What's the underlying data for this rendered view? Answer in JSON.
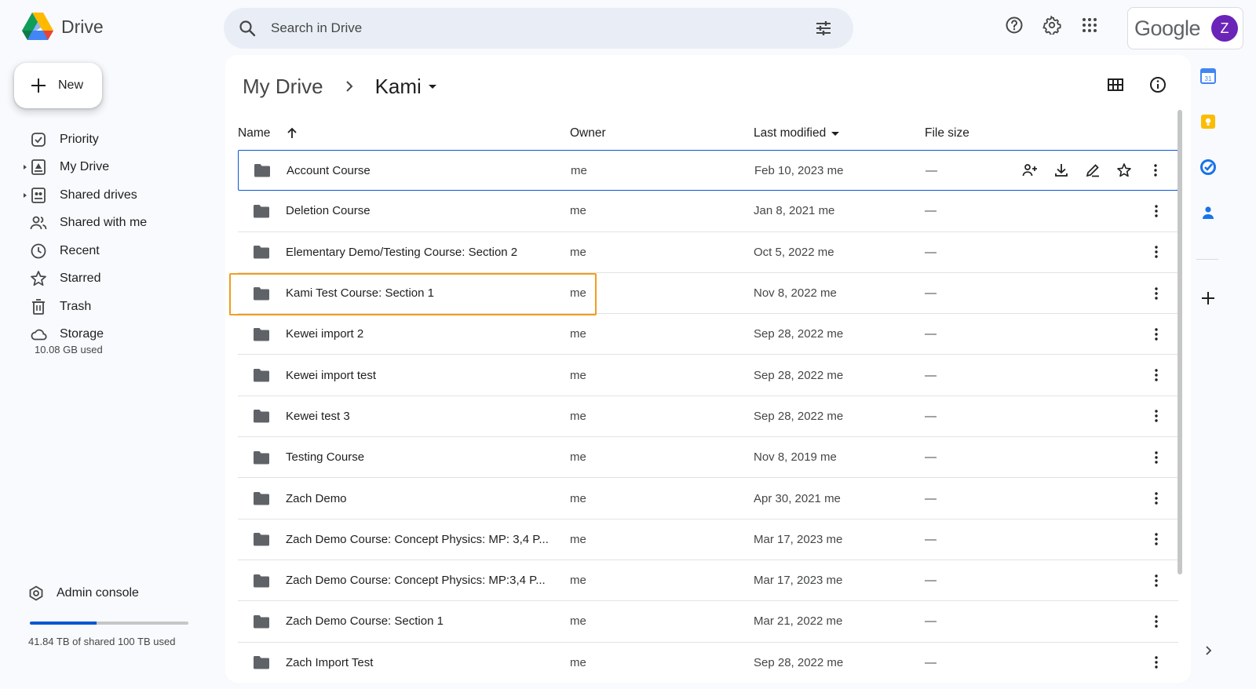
{
  "app": {
    "title": "Drive",
    "brand_colors": {
      "blue": "#4285f4",
      "green": "#0f9d58",
      "yellow": "#f4b400",
      "red": "#db4437"
    }
  },
  "search": {
    "placeholder": "Search in Drive",
    "icon": "search-icon",
    "filter_icon": "tune-icon"
  },
  "header_icons": [
    "help-icon",
    "settings-icon",
    "apps-grid-icon"
  ],
  "account": {
    "brand": "Google",
    "avatar_letter": "Z",
    "avatar_color": "#6a24b8"
  },
  "new_button": {
    "label": "New"
  },
  "sidebar": {
    "items": [
      {
        "label": "Priority",
        "icon": "priority-icon"
      },
      {
        "label": "My Drive",
        "icon": "my-drive-icon"
      },
      {
        "label": "Shared drives",
        "icon": "shared-drives-icon"
      },
      {
        "label": "Shared with me",
        "icon": "shared-with-me-icon"
      },
      {
        "label": "Recent",
        "icon": "clock-icon"
      },
      {
        "label": "Starred",
        "icon": "star-icon"
      },
      {
        "label": "Trash",
        "icon": "trash-icon"
      },
      {
        "label": "Storage",
        "icon": "cloud-icon"
      }
    ],
    "storage_used": "10.08 GB used",
    "admin_label": "Admin console",
    "quota_text": "41.84 TB of shared 100 TB used",
    "quota_fraction": 0.4184
  },
  "breadcrumb": {
    "root": "My Drive",
    "current": "Kami"
  },
  "table": {
    "headers": {
      "name": "Name",
      "owner": "Owner",
      "modified": "Last modified",
      "size": "File size"
    },
    "rows": [
      {
        "name": "Account Course",
        "owner": "me",
        "modified": "Feb 10, 2023 me",
        "size": "—"
      },
      {
        "name": "Deletion Course",
        "owner": "me",
        "modified": "Jan 8, 2021 me",
        "size": "—"
      },
      {
        "name": "Elementary Demo/Testing Course: Section 2",
        "owner": "me",
        "modified": "Oct 5, 2022 me",
        "size": "—"
      },
      {
        "name": "Kami Test Course: Section 1",
        "owner": "me",
        "modified": "Nov 8, 2022 me",
        "size": "—"
      },
      {
        "name": "Kewei import 2",
        "owner": "me",
        "modified": "Sep 28, 2022 me",
        "size": "—"
      },
      {
        "name": "Kewei import test",
        "owner": "me",
        "modified": "Sep 28, 2022 me",
        "size": "—"
      },
      {
        "name": "Kewei test 3",
        "owner": "me",
        "modified": "Sep 28, 2022 me",
        "size": "—"
      },
      {
        "name": "Testing Course",
        "owner": "me",
        "modified": "Nov 8, 2019 me",
        "size": "—"
      },
      {
        "name": "Zach Demo",
        "owner": "me",
        "modified": "Apr 30, 2021 me",
        "size": "—"
      },
      {
        "name": "Zach Demo Course: Concept Physics: MP: 3,4 P...",
        "owner": "me",
        "modified": "Mar 17, 2023 me",
        "size": "—"
      },
      {
        "name": "Zach Demo Course: Concept Physics: MP:3,4 P...",
        "owner": "me",
        "modified": "Mar 17, 2023 me",
        "size": "—"
      },
      {
        "name": "Zach Demo Course: Section 1",
        "owner": "me",
        "modified": "Mar 21, 2022 me",
        "size": "—"
      },
      {
        "name": "Zach Import Test",
        "owner": "me",
        "modified": "Sep 28, 2022 me",
        "size": "—"
      }
    ],
    "selected_row": "Account Course",
    "highlighted_row": "Kami Test Course: Section 1",
    "highlight_color": "#f29d1f",
    "row_actions": [
      "share-icon",
      "download-icon",
      "rename-icon",
      "star-icon",
      "more-icon"
    ]
  },
  "side_apps": [
    "calendar-icon",
    "keep-icon",
    "tasks-icon",
    "contacts-icon"
  ]
}
